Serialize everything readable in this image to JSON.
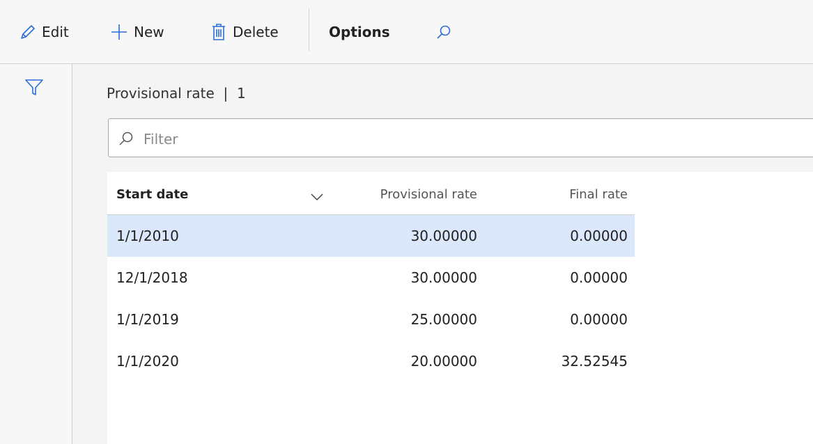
{
  "toolbar": {
    "edit_label": "Edit",
    "new_label": "New",
    "delete_label": "Delete",
    "options_label": "Options",
    "icons": [
      "pencil-icon",
      "plus-icon",
      "trash-icon",
      "search-icon"
    ]
  },
  "leftrail": {
    "icon": "filter-funnel-icon"
  },
  "grid": {
    "caption": "Provisional rate  |  1",
    "filter_placeholder": "Filter",
    "columns": [
      "Start date",
      "Provisional rate",
      "Final rate"
    ],
    "sort_icon": "chevron-down-icon",
    "selected_row_index": 0,
    "rows": [
      {
        "start_date": "1/1/2010",
        "provisional_rate": "30.00000",
        "final_rate": "0.00000"
      },
      {
        "start_date": "12/1/2018",
        "provisional_rate": "30.00000",
        "final_rate": "0.00000"
      },
      {
        "start_date": "1/1/2019",
        "provisional_rate": "25.00000",
        "final_rate": "0.00000"
      },
      {
        "start_date": "1/1/2020",
        "provisional_rate": "20.00000",
        "final_rate": "32.52545"
      }
    ]
  },
  "colors": {
    "selected_row": "#dbe7fb",
    "accent_icon": "#2b6cd6"
  }
}
